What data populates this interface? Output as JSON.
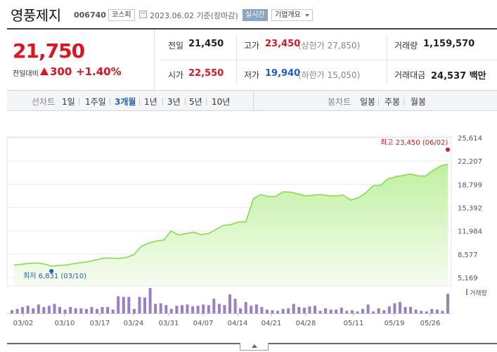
{
  "header": {
    "stock_name": "영풍제지",
    "stock_code": "006740",
    "market": "코스피",
    "date_text": "2023.06.02 기준(장마감)",
    "realtime": "실시간",
    "company_overview": "기업개요"
  },
  "quote": {
    "current_price": "21,750",
    "prev_compare_label": "전일대비",
    "change_amount": "300",
    "change_percent": "+1.40%",
    "prev_close_label": "전일",
    "prev_close": "21,450",
    "high_label": "고가",
    "high": "23,450",
    "upper_limit": "(상한가 27,850)",
    "volume_label": "거래량",
    "volume": "1,159,570",
    "open_label": "시가",
    "open": "22,550",
    "low_label": "저가",
    "low": "19,940",
    "lower_limit": "(하한가 15,050)",
    "amount_label": "거래대금",
    "amount": "24,537 백만"
  },
  "periods": {
    "label": "선차트",
    "items": [
      "1일",
      "1주일",
      "3개월",
      "1년",
      "3년",
      "5년",
      "10년"
    ],
    "active": "3개월",
    "candle_label": "봉차트",
    "candle_items": [
      "일봉",
      "주봉",
      "월봉"
    ]
  },
  "colors": {
    "up": "#e0131e",
    "down": "#1f5cc7",
    "area_line": "#7fdc45",
    "volume_bar": "#9b7fc6"
  },
  "chart_data": {
    "type": "area",
    "y_ticks": [
      "25,614",
      "22,207",
      "18,799",
      "15,392",
      "11,984",
      "8,577",
      "5,169"
    ],
    "ylim": [
      5169,
      25614
    ],
    "x_ticks": [
      "03/02",
      "03/10",
      "03/17",
      "03/24",
      "03/31",
      "04/07",
      "04/14",
      "04/21",
      "04/28",
      "05/11",
      "05/19",
      "05/26"
    ],
    "high_annotation": "최고 23,450 (06/02)",
    "low_annotation": "최저 6,831 (03/10)",
    "volume_legend": "거래량",
    "price_series": [
      7000,
      7100,
      7250,
      7300,
      7150,
      6831,
      6950,
      7000,
      7200,
      7350,
      7500,
      7750,
      8000,
      8000,
      7950,
      8100,
      8500,
      9700,
      10200,
      10500,
      10650,
      11950,
      11400,
      11600,
      11800,
      11450,
      11600,
      12200,
      12800,
      12900,
      13300,
      13300,
      16700,
      17300,
      17000,
      17050,
      17700,
      17650,
      17400,
      17100,
      17200,
      17300,
      17150,
      17100,
      17200,
      16500,
      16800,
      17500,
      18600,
      18650,
      19600,
      19900,
      20100,
      20300,
      20050,
      20000,
      20800,
      21450,
      21750
    ],
    "volume_series": [
      10,
      14,
      20,
      24,
      16,
      28,
      20,
      24,
      30,
      20,
      12,
      20,
      16,
      16,
      14,
      20,
      14,
      20,
      20,
      12,
      54,
      52,
      52,
      14,
      52,
      50,
      80,
      30,
      32,
      26,
      14,
      24,
      26,
      28,
      22,
      24,
      28,
      26,
      46,
      30,
      26,
      60,
      46,
      16,
      36,
      24,
      28,
      20,
      12,
      10,
      8,
      14,
      16,
      30,
      20,
      18,
      22,
      24,
      8,
      16,
      12,
      12,
      18,
      8,
      10,
      6,
      14,
      28,
      6,
      16,
      10,
      22,
      32,
      36,
      20,
      20,
      12,
      8,
      6,
      14,
      12,
      8,
      62
    ]
  }
}
